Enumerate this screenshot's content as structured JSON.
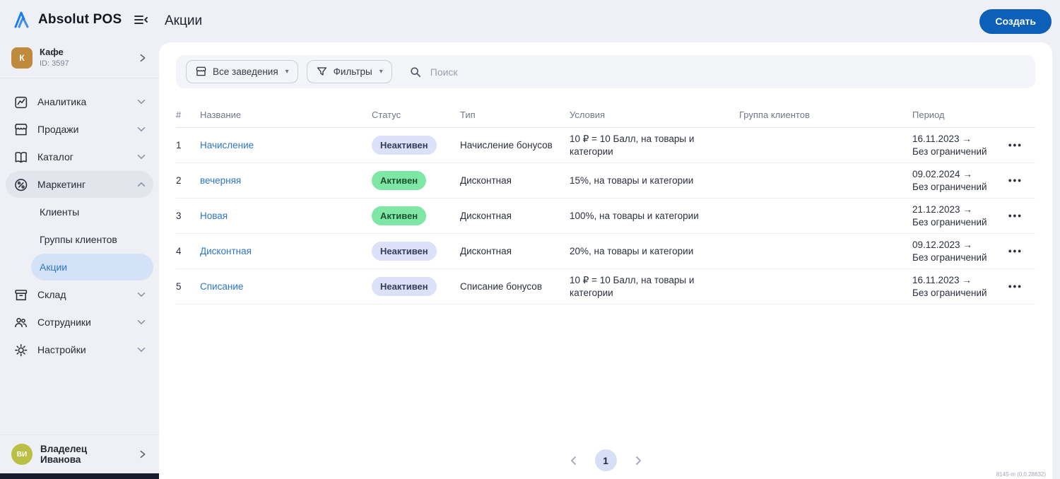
{
  "app": {
    "brand": "Absolut POS",
    "page_title": "Акции",
    "create_button": "Создать",
    "version": "8145-m (0.0.28632)"
  },
  "venue": {
    "initial": "К",
    "name": "Кафе",
    "id_label": "ID: 3597"
  },
  "sidebar": {
    "items": [
      {
        "label": "Аналитика",
        "icon": "analytics-icon",
        "state": "collapsed"
      },
      {
        "label": "Продажи",
        "icon": "storefront-icon",
        "state": "collapsed"
      },
      {
        "label": "Каталог",
        "icon": "catalog-icon",
        "state": "collapsed"
      },
      {
        "label": "Маркетинг",
        "icon": "marketing-icon",
        "state": "expanded",
        "children": [
          {
            "label": "Клиенты",
            "active": false
          },
          {
            "label": "Группы клиентов",
            "active": false
          },
          {
            "label": "Акции",
            "active": true
          }
        ]
      },
      {
        "label": "Склад",
        "icon": "warehouse-icon",
        "state": "collapsed"
      },
      {
        "label": "Сотрудники",
        "icon": "staff-icon",
        "state": "collapsed"
      },
      {
        "label": "Настройки",
        "icon": "settings-icon",
        "state": "collapsed"
      }
    ]
  },
  "user": {
    "initials": "ВИ",
    "name": "Владелец Иванова"
  },
  "filters": {
    "venues_button": "Все заведения",
    "filters_button": "Фильтры",
    "search_placeholder": "Поиск"
  },
  "table": {
    "headers": [
      "#",
      "Название",
      "Статус",
      "Тип",
      "Условия",
      "Группа клиентов",
      "Период"
    ],
    "rows": [
      {
        "num": "1",
        "name": "Начисление",
        "status": "Неактивен",
        "status_type": "inactive",
        "type": "Начисление бонусов",
        "conditions": "10 ₽ = 10 Балл, на товары и категории",
        "client_group": "",
        "period_start": "16.11.2023 →",
        "period_end": "Без ограничений"
      },
      {
        "num": "2",
        "name": "вечерняя",
        "status": "Активен",
        "status_type": "active",
        "type": "Дисконтная",
        "conditions": "15%, на товары и категории",
        "client_group": "",
        "period_start": "09.02.2024 →",
        "period_end": "Без ограничений"
      },
      {
        "num": "3",
        "name": "Новая",
        "status": "Активен",
        "status_type": "active",
        "type": "Дисконтная",
        "conditions": "100%, на товары и категории",
        "client_group": "",
        "period_start": "21.12.2023 →",
        "period_end": "Без ограничений"
      },
      {
        "num": "4",
        "name": "Дисконтная",
        "status": "Неактивен",
        "status_type": "inactive",
        "type": "Дисконтная",
        "conditions": "20%, на товары и категории",
        "client_group": "",
        "period_start": "09.12.2023 →",
        "period_end": "Без ограничений"
      },
      {
        "num": "5",
        "name": "Списание",
        "status": "Неактивен",
        "status_type": "inactive",
        "type": "Списание бонусов",
        "conditions": "10 ₽ = 10 Балл, на товары и категории",
        "client_group": "",
        "period_start": "16.11.2023 →",
        "period_end": "Без ограничений"
      }
    ]
  },
  "pagination": {
    "current": "1"
  },
  "colors": {
    "accent_blue": "#0D5FB8",
    "link_blue": "#2E75C8",
    "badge_active_bg": "#7EE7A5",
    "badge_inactive_bg": "#DCE0F8",
    "sidebar_bg": "#EEF0F6",
    "selected_item_bg": "#D4E2F7"
  }
}
